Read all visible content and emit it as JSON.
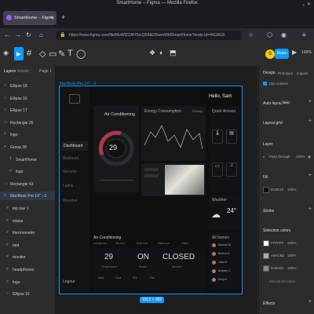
{
  "browser": {
    "window_title": "SmartHome – Figma — Mozilla Firefox",
    "tab_title": "SmartHome – Figma",
    "url": "https://www.figma.com/file/MvWfZZAHTocQ5AtEOhemWbfSmartHome?node-id=4%3A18",
    "new_tab_glyph": "+"
  },
  "figma": {
    "toolbar": {
      "tools": [
        "▸",
        "#",
        "◇",
        "▭",
        "✎",
        "T",
        "◯"
      ],
      "avatar_initial": "S",
      "share_label": "Share",
      "play_glyph": "▶",
      "zoom_level": "100%"
    },
    "layers_panel": {
      "tab_layers": "Layers",
      "tab_assets": "Assets",
      "page": "Page 1",
      "items": [
        {
          "name": "Ellipse 18",
          "icon": "○"
        },
        {
          "name": "Ellipse 16",
          "icon": "○"
        },
        {
          "name": "Ellipse 17",
          "icon": "○"
        },
        {
          "name": "Rectangle 26",
          "icon": "▭"
        },
        {
          "name": "logo",
          "icon": "#"
        },
        {
          "name": "Group 38",
          "icon": "▾"
        },
        {
          "name": "SmartHome",
          "icon": "T"
        },
        {
          "name": "logo",
          "icon": "#"
        },
        {
          "name": "Rectangle 43",
          "icon": "▭"
        },
        {
          "name": "MacBook Pro 14\" - 3",
          "icon": "#"
        },
        {
          "name": "top nav 1",
          "icon": "#"
        },
        {
          "name": "status",
          "icon": "#"
        },
        {
          "name": "thermometer",
          "icon": "#"
        },
        {
          "name": "bed",
          "icon": "#"
        },
        {
          "name": "monitor",
          "icon": "#"
        },
        {
          "name": "headphones",
          "icon": "#"
        },
        {
          "name": "logo",
          "icon": "#"
        },
        {
          "name": "Ellipse 19",
          "icon": "○"
        }
      ]
    },
    "canvas": {
      "frame_label": "MacBook Pro 14\" - 3",
      "size_badge": "1512 × 982"
    },
    "design": {
      "greeting": "Hello, Sam",
      "nav": [
        "Dashboard",
        "Bedroom",
        "Security",
        "Lights",
        "Weather"
      ],
      "logout": "Logout",
      "ac_title": "Air Conditioning",
      "ac_temp": "29",
      "energy_title": "Energy Consumption",
      "energy_filter": "Weekly",
      "quick_access": "Quick Access",
      "weather_title": "Weather",
      "weather_temp": "24°",
      "ac_section": "Air Conditioning",
      "ac_tabs": [
        "Livingroom",
        "Kitchen",
        "Bedroom",
        "Bathroom",
        "Office"
      ],
      "ac_values": [
        "29",
        "ON",
        "CLOSED"
      ],
      "ac_value_labels": [
        "Temperature",
        "Power",
        "Window"
      ],
      "ac_modes": [
        "Auto",
        "Cool",
        "Dry",
        "Fan"
      ],
      "all_homes": "All homes",
      "homes": [
        "Samuel W.",
        "Bianca D.",
        "Julia M.",
        "Bradley C.",
        "Kelly K."
      ]
    },
    "properties_panel": {
      "tab_design": "Design",
      "tab_prototype": "Prototype",
      "tab_inspect": "Inspect",
      "clip_content": "Clip content",
      "auto_layout": "Auto layout",
      "auto_layout_badge": "New",
      "layout_grid": "Layout grid",
      "layer": "Layer",
      "blend": "Pass through",
      "opacity": "100%",
      "fill": "Fill",
      "fill_hex": "0C0E10",
      "fill_opacity": "100%",
      "stroke": "Stroke",
      "selection_colors": "Selection colors",
      "colors": [
        {
          "hex": "FFFFFF",
          "op": "100%",
          "swatch": "#FFFFFF"
        },
        {
          "hex": "A8ACB2",
          "op": "100%",
          "swatch": "#A8ACB2"
        },
        {
          "hex": "8A8A8A",
          "op": "100%",
          "swatch": "#8A8A8A"
        }
      ],
      "see_all": "See all 22 colors",
      "effects": "Effects"
    }
  }
}
